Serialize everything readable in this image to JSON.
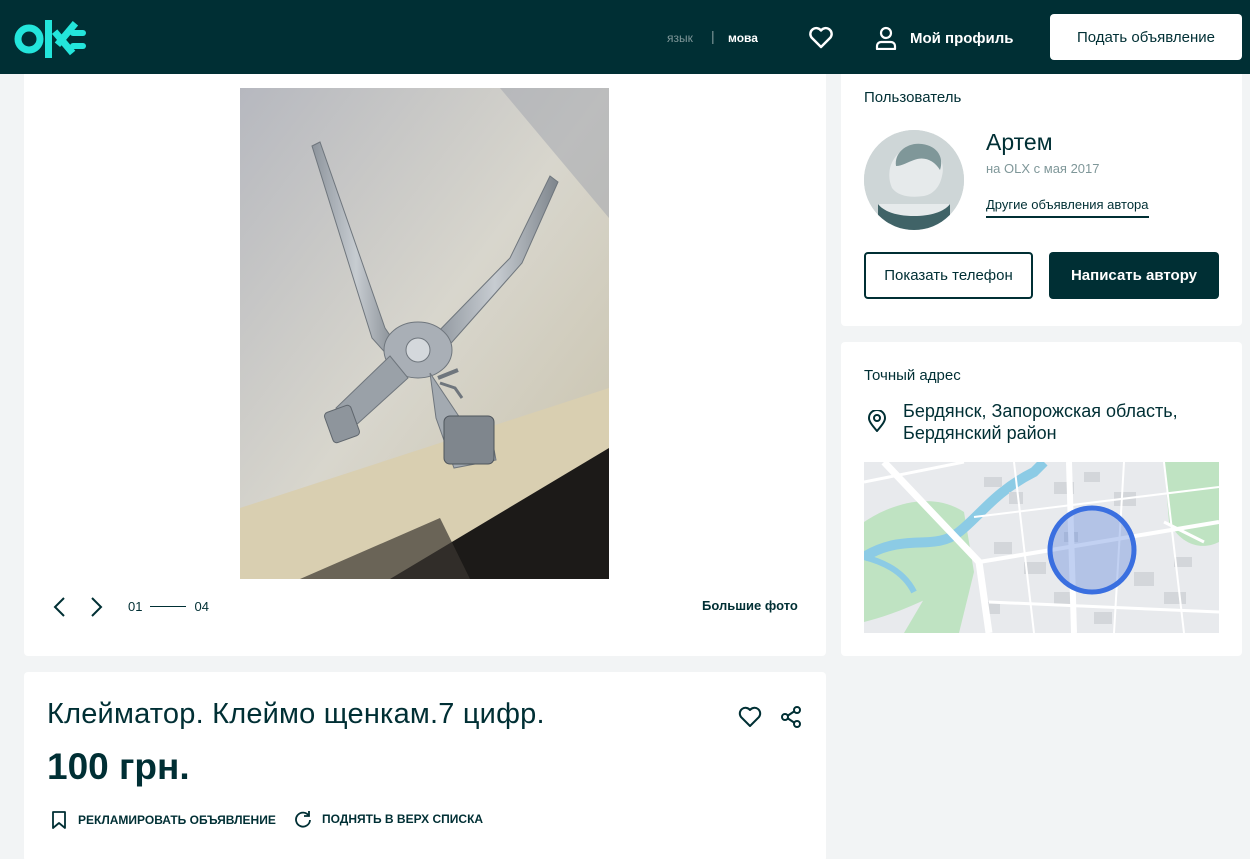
{
  "header": {
    "logo": "olx",
    "lang_inactive": "язык",
    "lang_active": "мова",
    "profile_label": "Мой профиль",
    "post_button": "Подать объявление",
    "colors": {
      "background": "#002f34",
      "logo": "#23e5db"
    }
  },
  "gallery": {
    "counter_current": "01",
    "counter_total": "04",
    "big_photo_label": "Большие фото"
  },
  "ad": {
    "title": "Клейматор. Клеймо щенкам.7 цифр.",
    "price": "100 грн.",
    "promote_label": "РЕКЛАМИРОВАТЬ ОБЪЯВЛЕНИЕ",
    "raise_label": "ПОДНЯТЬ В ВЕРХ СПИСКА"
  },
  "user": {
    "section_label": "Пользователь",
    "name": "Артем",
    "since": "на OLX с мая 2017",
    "other_ads_link": "Другие объявления автора",
    "show_phone_button": "Показать телефон",
    "write_button": "Написать автору"
  },
  "address": {
    "section_label": "Точный адрес",
    "text": "Бердянск, Запорожская область, Бердянский район"
  }
}
